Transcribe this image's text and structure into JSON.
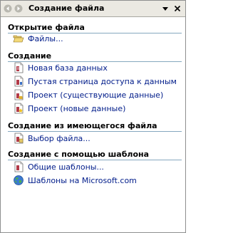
{
  "pane": {
    "title": "Создание файла"
  },
  "sections": [
    {
      "header": "Открытие файла",
      "items": [
        {
          "label": "Файлы...",
          "icon": "folder-open-icon"
        }
      ]
    },
    {
      "header": "Создание",
      "items": [
        {
          "label": "Новая база данных",
          "icon": "database-file-icon"
        },
        {
          "label": "Пустая страница доступа к данным",
          "icon": "data-access-page-icon"
        },
        {
          "label": "Проект (существующие данные)",
          "icon": "project-existing-icon"
        },
        {
          "label": "Проект (новые данные)",
          "icon": "project-new-icon"
        }
      ]
    },
    {
      "header": "Создание из имеющегося файла",
      "items": [
        {
          "label": "Выбор файла...",
          "icon": "choose-file-icon"
        }
      ]
    },
    {
      "header": "Создание с помощью шаблона",
      "items": [
        {
          "label": "Общие шаблоны...",
          "icon": "templates-icon"
        },
        {
          "label": "Шаблоны на Microsoft.com",
          "icon": "globe-icon"
        }
      ]
    }
  ],
  "colors": {
    "title_bar_bg": "#ebe9e2",
    "link_text": "#001c8a",
    "section_rule": "#86a8bf",
    "pane_border": "#8e8f8f"
  }
}
